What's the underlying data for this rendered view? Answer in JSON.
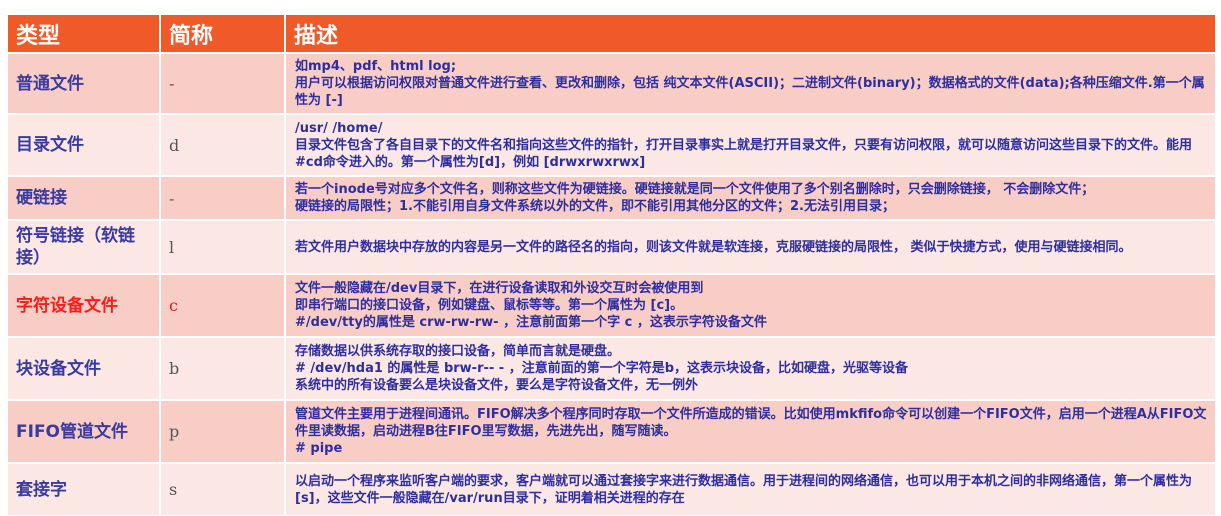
{
  "header": {
    "col_type": "类型",
    "col_abbr": "简称",
    "col_desc": "描述"
  },
  "rows": [
    {
      "name": "普通文件",
      "abbr": "-",
      "lines": [
        "如mp4、pdf、html log;",
        "用户可以根据访问权限对普通文件进行查看、更改和删除，包括 纯文本文件(ASCII)；二进制文件(binary)；数据格式的文件(data);各种压缩文件.第一个属性为 [-]"
      ]
    },
    {
      "name": "目录文件",
      "abbr": "d",
      "lines": [
        "/usr/ /home/",
        "目录文件包含了各自目录下的文件名和指向这些文件的指针，打开目录事实上就是打开目录文件，只要有访问权限，就可以随意访问这些目录下的文件。能用#cd命令进入的。第一个属性为[d]，例如 [drwxrwxrwx]"
      ]
    },
    {
      "name": "硬链接",
      "abbr": "-",
      "lines": [
        "若一个inode号对应多个文件名，则称这些文件为硬链接。硬链接就是同一个文件使用了多个别名删除时，只会删除链接， 不会删除文件；",
        "硬链接的局限性；1.不能引用自身文件系统以外的文件，即不能引用其他分区的文件；2.无法引用目录；"
      ]
    },
    {
      "name": "符号链接（软链接）",
      "abbr": "l",
      "lines": [
        "若文件用户数据块中存放的内容是另一文件的路径名的指向，则该文件就是软连接，克服硬链接的局限性， 类似于快捷方式，使用与硬链接相同。"
      ]
    },
    {
      "name": "字符设备文件",
      "abbr": "c",
      "highlight": true,
      "lines": [
        "文件一般隐藏在/dev目录下，在进行设备读取和外设交互时会被使用到",
        "即串行端口的接口设备，例如键盘、鼠标等等。第一个属性为 [c]。",
        "#/dev/tty的属性是 crw-rw-rw- ，注意前面第一个字 c ，这表示字符设备文件"
      ]
    },
    {
      "name": "块设备文件",
      "abbr": "b",
      "lines": [
        "存储数据以供系统存取的接口设备，简单而言就是硬盘。",
        "# /dev/hda1 的属性是 brw-r-- - ，注意前面的第一个字符是b，这表示块设备，比如硬盘，光驱等设备",
        "系统中的所有设备要么是块设备文件，要么是字符设备文件，无一例外"
      ]
    },
    {
      "name": "FIFO管道文件",
      "abbr": "p",
      "lines": [
        "管道文件主要用于进程间通讯。FIFO解决多个程序同时存取一个文件所造成的错误。比如使用mkfifo命令可以创建一个FIFO文件，启用一个进程A从FIFO文件里读数据，启动进程B往FIFO里写数据，先进先出，随写随读。",
        "# pipe"
      ]
    },
    {
      "name": "套接字",
      "abbr": "s",
      "lines": [
        "以启动一个程序来监听客户端的要求，客户端就可以通过套接字来进行数据通信。用于进程间的网络通信，也可以用于本机之间的非网络通信，第一个属性为 [s]，这些文件一般隐藏在/var/run目录下，证明着相关进程的存在"
      ]
    }
  ]
}
